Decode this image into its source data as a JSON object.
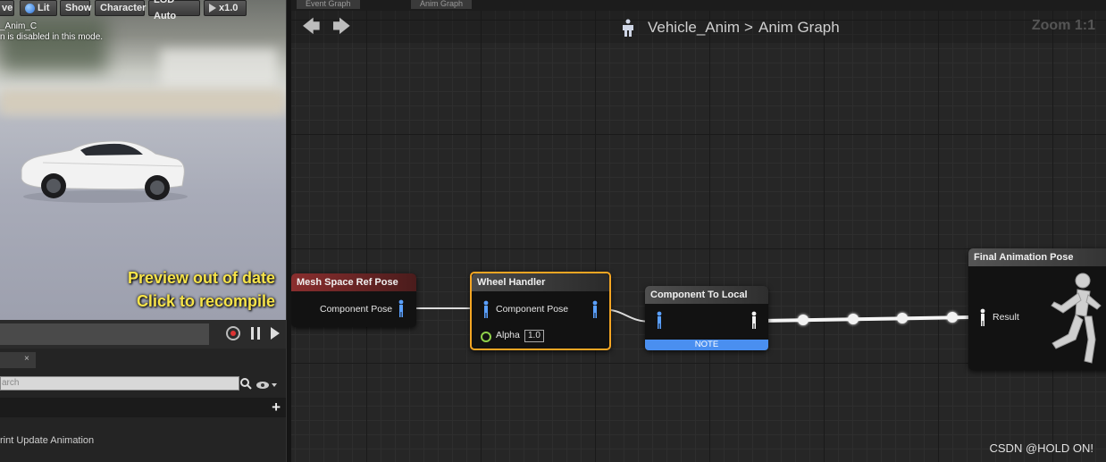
{
  "viewport": {
    "toolbar": {
      "save_partial": "ve",
      "lit": "Lit",
      "show": "Show",
      "character": "Character",
      "lod": "LOD Auto",
      "speed": "x1.0"
    },
    "info_line1": "_Anim_C",
    "info_line2": "n is disabled in this mode.",
    "preview_line1": "Preview out of date",
    "preview_line2": "Click to recompile"
  },
  "left_panel": {
    "tab_close": "×",
    "search_placeholder": "arch",
    "add_symbol": "+",
    "item": "rint Update Animation"
  },
  "graph": {
    "tabs": [
      "Event Graph",
      "Anim Graph"
    ],
    "breadcrumb_blueprint": "Vehicle_Anim",
    "breadcrumb_sep": ">",
    "breadcrumb_graph": "Anim Graph",
    "zoom": "Zoom 1:1"
  },
  "nodes": {
    "mesh_space": {
      "title": "Mesh Space Ref Pose",
      "pin_out": "Component Pose"
    },
    "wheel_handler": {
      "title": "Wheel Handler",
      "pin_pose": "Component Pose",
      "pin_alpha": "Alpha",
      "alpha_value": "1.0"
    },
    "component_to_local": {
      "title": "Component To Local",
      "note": "NOTE"
    },
    "final_pose": {
      "title": "Final Animation Pose",
      "pin_result": "Result"
    }
  },
  "colors": {
    "mesh_header": "#7a2a2a",
    "wheel_header": "#3d3d3d",
    "wheel_border": "#f5a623",
    "ctl_header": "#4a4a4a",
    "note_bar": "#4a8ff0",
    "pin_blue": "#5aa0ff",
    "preview_text": "#f7e44a"
  },
  "watermark": "CSDN @HOLD ON!"
}
